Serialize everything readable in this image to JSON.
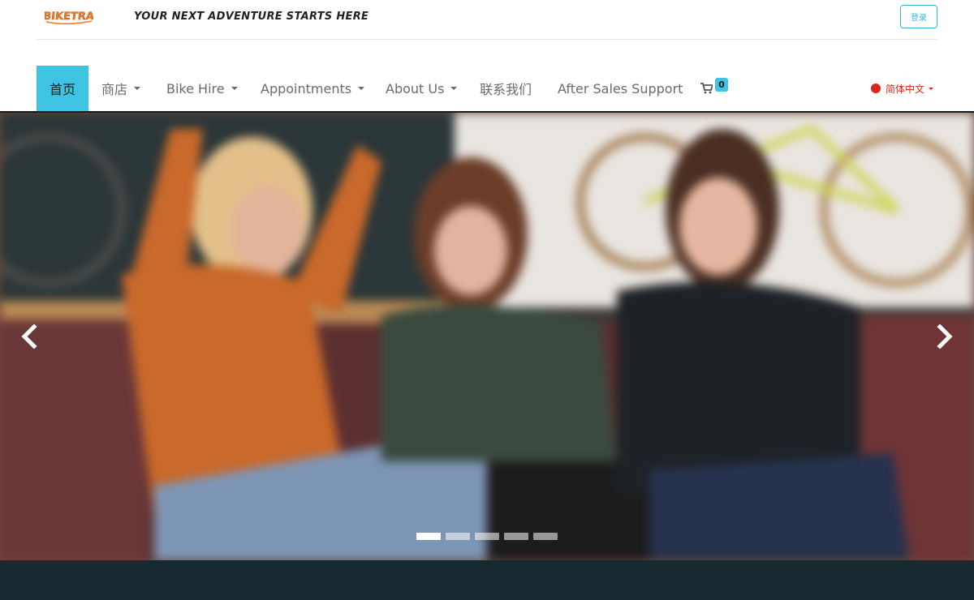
{
  "header": {
    "logo_text": "BIKETRAX",
    "tagline": "YOUR NEXT ADVENTURE STARTS HERE",
    "login_label": "登录"
  },
  "nav": {
    "items": [
      {
        "label": "首页",
        "active": true,
        "dropdown": false
      },
      {
        "label": "商店",
        "active": false,
        "dropdown": true
      },
      {
        "label": "Bike Hire",
        "active": false,
        "dropdown": true
      },
      {
        "label": "Appointments",
        "active": false,
        "dropdown": true
      },
      {
        "label": "About Us",
        "active": false,
        "dropdown": true
      },
      {
        "label": "联系我们",
        "active": false,
        "dropdown": false
      },
      {
        "label": "After Sales Support",
        "active": false,
        "dropdown": false
      }
    ],
    "cart_count": "0",
    "cart_icon": "shopping-cart-icon",
    "language": "简体中文"
  },
  "carousel": {
    "slide_count": 5,
    "active_index": 0,
    "prev_icon": "chevron-left-icon",
    "next_icon": "chevron-right-icon"
  },
  "colors": {
    "accent": "#3fc3e3",
    "logo": "#f07a22",
    "language": "#d9261c",
    "footer_band": "#172a30"
  }
}
